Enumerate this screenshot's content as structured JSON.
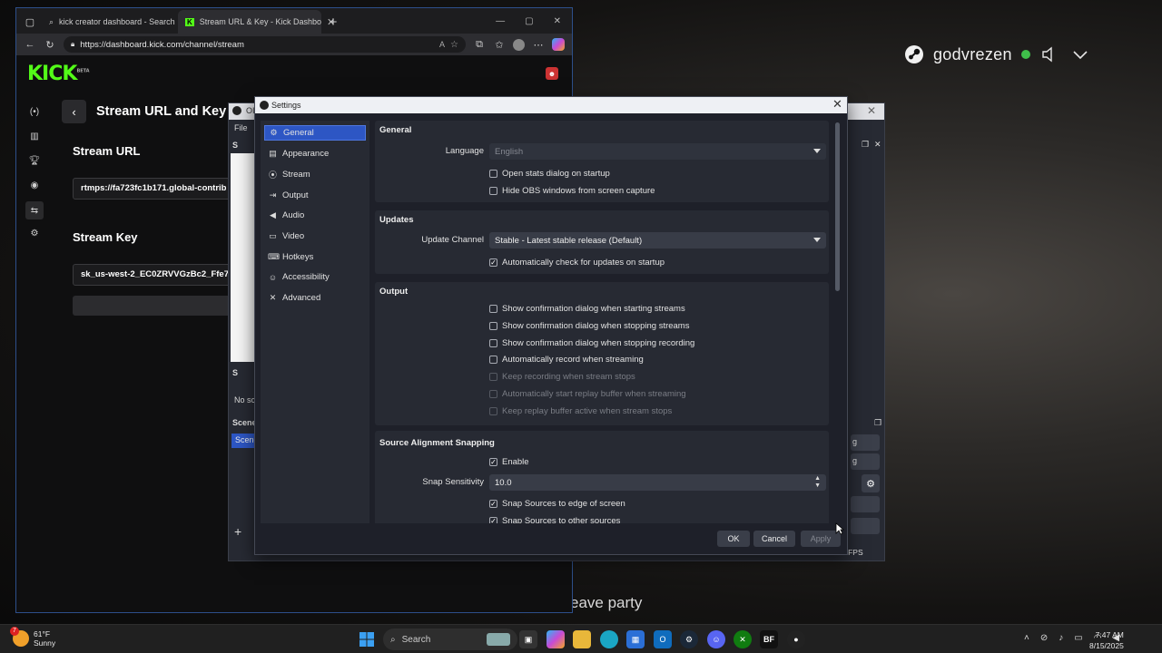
{
  "steam_overlay": {
    "username": "godvrezen",
    "status_color": "#3fbf4a",
    "leave_party": "eave party"
  },
  "browser": {
    "tabs": [
      {
        "label": "kick creator dashboard - Search",
        "icon": "search-icon"
      },
      {
        "label": "Stream URL & Key - Kick Dashbo",
        "icon": "kick-icon",
        "active": true
      }
    ],
    "url": "https://dashboard.kick.com/channel/stream",
    "logo": "KICK",
    "logo_badge": "BETA",
    "page_title": "Stream URL and Key",
    "stream_url_label": "Stream URL",
    "stream_url_value": "rtmps://fa723fc1b171.global-contrib",
    "stream_key_label": "Stream Key",
    "stream_key_value": "sk_us-west-2_EC0ZRVVGzBc2_Ffe7"
  },
  "obs_main": {
    "title": "OI",
    "menu_file": "File",
    "sources_label": "S",
    "scenes_header_label": "S",
    "no_sources": "No sc",
    "scenes_label": "Scene",
    "scene_item": "Scene",
    "dock_btn_1": "g",
    "dock_btn_2": "g",
    "fps": "0 FPS"
  },
  "settings": {
    "title": "Settings",
    "nav": [
      {
        "label": "General",
        "icon": "gear-icon"
      },
      {
        "label": "Appearance",
        "icon": "appearance-icon"
      },
      {
        "label": "Stream",
        "icon": "antenna-icon"
      },
      {
        "label": "Output",
        "icon": "output-icon"
      },
      {
        "label": "Audio",
        "icon": "speaker-icon"
      },
      {
        "label": "Video",
        "icon": "monitor-icon"
      },
      {
        "label": "Hotkeys",
        "icon": "keyboard-icon"
      },
      {
        "label": "Accessibility",
        "icon": "accessibility-icon"
      },
      {
        "label": "Advanced",
        "icon": "tools-icon"
      }
    ],
    "general": {
      "heading": "General",
      "language_label": "Language",
      "language_value": "English",
      "open_stats": "Open stats dialog on startup",
      "hide_obs": "Hide OBS windows from screen capture"
    },
    "updates": {
      "heading": "Updates",
      "channel_label": "Update Channel",
      "channel_value": "Stable - Latest stable release (Default)",
      "auto_check": "Automatically check for updates on startup"
    },
    "output": {
      "heading": "Output",
      "items": [
        {
          "label": "Show confirmation dialog when starting streams",
          "checked": false,
          "disabled": false
        },
        {
          "label": "Show confirmation dialog when stopping streams",
          "checked": false,
          "disabled": false
        },
        {
          "label": "Show confirmation dialog when stopping recording",
          "checked": false,
          "disabled": false
        },
        {
          "label": "Automatically record when streaming",
          "checked": false,
          "disabled": false
        },
        {
          "label": "Keep recording when stream stops",
          "checked": false,
          "disabled": true
        },
        {
          "label": "Automatically start replay buffer when streaming",
          "checked": false,
          "disabled": true
        },
        {
          "label": "Keep replay buffer active when stream stops",
          "checked": false,
          "disabled": true
        }
      ]
    },
    "snapping": {
      "heading": "Source Alignment Snapping",
      "enable": "Enable",
      "sensitivity_label": "Snap Sensitivity",
      "sensitivity_value": "10.0",
      "edge": "Snap Sources to edge of screen",
      "other": "Snap Sources to other sources"
    },
    "buttons": {
      "ok": "OK",
      "cancel": "Cancel",
      "apply": "Apply"
    }
  },
  "taskbar": {
    "temp": "61°F",
    "condition": "Sunny",
    "weather_badge": "7",
    "search_placeholder": "Search",
    "time": "7:47 AM",
    "date": "8/15/2025",
    "apps": [
      "windows-start-icon",
      "widget-icon",
      "taskview-icon",
      "copilot-icon",
      "file-explorer-icon",
      "edge-icon",
      "store-icon",
      "outlook-icon",
      "steam-icon",
      "discord-icon",
      "xbox-icon",
      "bf-icon",
      "obs-icon"
    ]
  }
}
